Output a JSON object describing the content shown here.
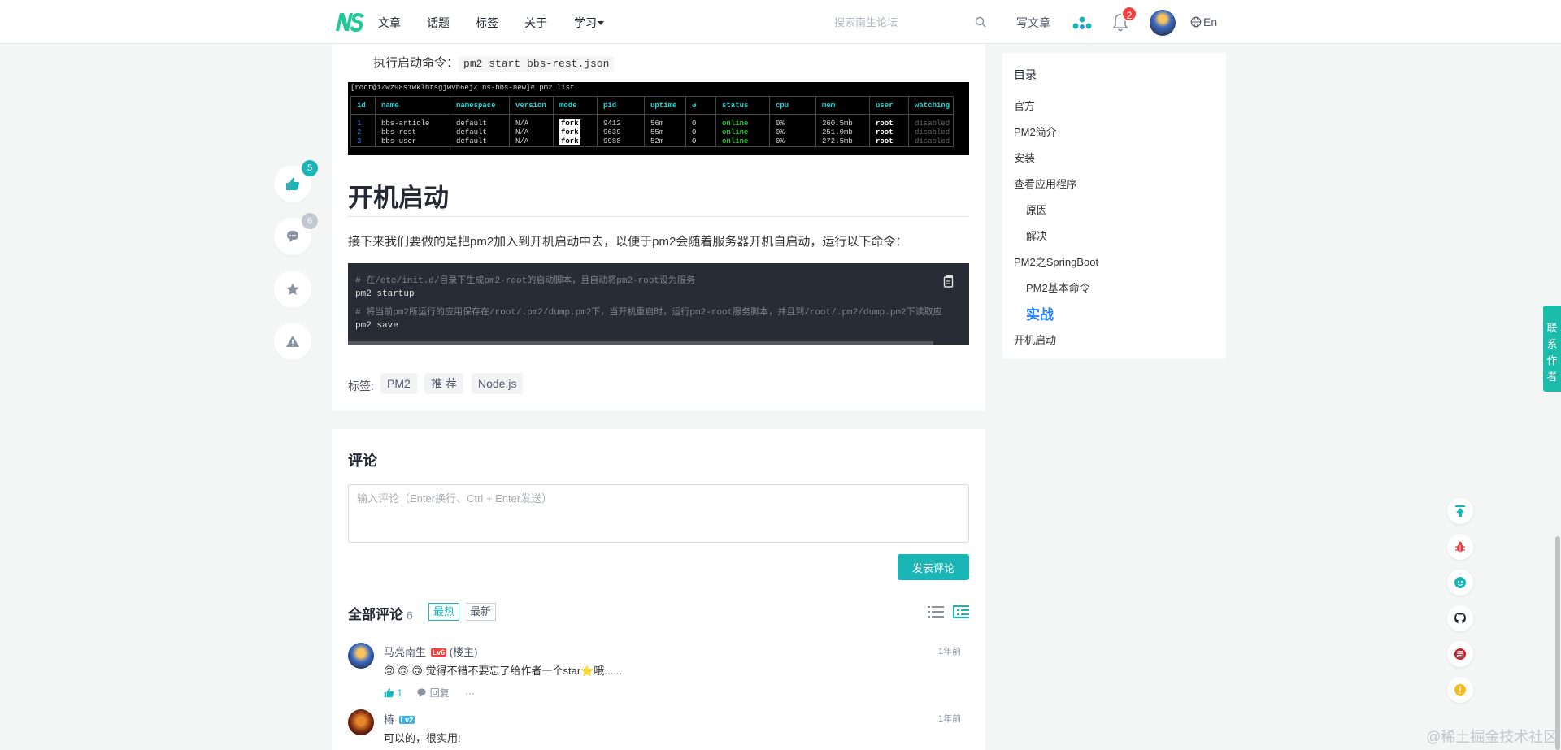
{
  "header": {
    "nav": [
      "文章",
      "话题",
      "标签",
      "关于",
      "学习"
    ],
    "search_placeholder": "搜索南生论坛",
    "write_label": "写文章",
    "notif_count": "2",
    "lang_label": "En"
  },
  "article": {
    "cmd_prefix": "执行启动命令：",
    "cmd_code": "pm2 start bbs-rest.json",
    "terminal": {
      "prompt": "[root@iZwz98s1wklbtsgjwvh6ejZ ns-bbs-new]# pm2 list",
      "headers": [
        "id",
        "name",
        "namespace",
        "version",
        "mode",
        "pid",
        "uptime",
        "↺",
        "status",
        "cpu",
        "mem",
        "user",
        "watching"
      ],
      "rows": [
        [
          "1",
          "bbs-article",
          "default",
          "N/A",
          "fork",
          "9412",
          "56m",
          "0",
          "online",
          "0%",
          "260.5mb",
          "root",
          "disabled"
        ],
        [
          "2",
          "bbs-rest",
          "default",
          "N/A",
          "fork",
          "9639",
          "55m",
          "0",
          "online",
          "0%",
          "251.0mb",
          "root",
          "disabled"
        ],
        [
          "3",
          "bbs-user",
          "default",
          "N/A",
          "fork",
          "9988",
          "52m",
          "0",
          "online",
          "0%",
          "272.5mb",
          "root",
          "disabled"
        ]
      ]
    },
    "heading": "开机启动",
    "paragraph": "接下来我们要做的是把pm2加入到开机启动中去，以便于pm2会随着服务器开机自启动，运行以下命令：",
    "code_lines": [
      "# 在/etc/init.d/目录下生成pm2-root的启动脚本，且自动将pm2-root设为服务",
      "pm2 startup",
      "# 将当前pm2所运行的应用保存在/root/.pm2/dump.pm2下，当开机重启时，运行pm2-root服务脚本，并且到/root/.pm2/dump.pm2下读取应",
      "pm2 save"
    ],
    "tags_label": "标签:",
    "tags": [
      "PM2",
      "推 荐",
      "Node.js"
    ]
  },
  "actions": {
    "like_count": "5",
    "comment_count": "6"
  },
  "toc": {
    "title": "目录",
    "items": [
      "官方",
      "PM2简介",
      "安装",
      "查看应用程序",
      "原因",
      "解决",
      "PM2之SpringBoot",
      "PM2基本命令",
      "实战",
      "开机启动"
    ]
  },
  "comments": {
    "title": "评论",
    "placeholder": "输入评论（Enter换行、Ctrl + Enter发送）",
    "submit_label": "发表评论",
    "all_label": "全部评论",
    "all_count": "6",
    "sort_hot": "最热",
    "sort_new": "最新",
    "list": [
      {
        "name": "马亮南生",
        "level": "Lv6",
        "role": "(楼主)",
        "time": "1年前",
        "text": "🙃 🙃 🙃 觉得不错不要忘了给作者一个star⭐哦......",
        "likes": "1",
        "reply_label": "回复",
        "more": "···"
      },
      {
        "name": "椿",
        "level": "Lv2",
        "time": "1年前",
        "text": "可以的，很实用!"
      }
    ]
  },
  "contact_label": "联系作者",
  "watermark": "@稀土掘金技术社区",
  "colors": {
    "accent": "#1bb5b5",
    "toc_active": "#1e80ff",
    "badge": "#f53f3f"
  }
}
